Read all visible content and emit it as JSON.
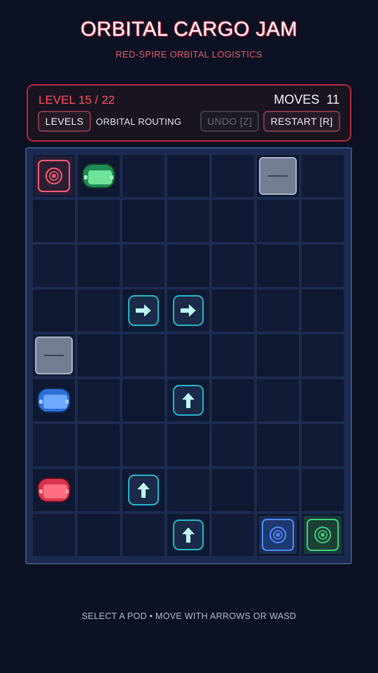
{
  "title": "ORBITAL CARGO JAM",
  "subtitle": "RED-SPIRE ORBITAL LOGISTICS",
  "hud": {
    "level_label": "LEVEL 15 / 22",
    "moves_label": "MOVES",
    "moves_value": "11",
    "levels_button": "LEVELS",
    "mode_label": "ORBITAL ROUTING",
    "undo_button": "UNDO [Z]",
    "restart_button": "RESTART  [R]"
  },
  "board": {
    "columns": 7,
    "rows": 9,
    "tiles": [
      {
        "type": "target",
        "color": "red",
        "col": 0,
        "row": 0
      },
      {
        "type": "pod",
        "color": "green",
        "col": 1,
        "row": 0
      },
      {
        "type": "wall",
        "col": 5,
        "row": 0
      },
      {
        "type": "arrow",
        "direction": "right",
        "col": 2,
        "row": 3
      },
      {
        "type": "arrow",
        "direction": "right",
        "col": 3,
        "row": 3
      },
      {
        "type": "wall",
        "col": 0,
        "row": 4
      },
      {
        "type": "pod",
        "color": "blue",
        "col": 0,
        "row": 5
      },
      {
        "type": "arrow",
        "direction": "up",
        "col": 3,
        "row": 5
      },
      {
        "type": "pod",
        "color": "red",
        "col": 0,
        "row": 7
      },
      {
        "type": "arrow",
        "direction": "up",
        "col": 2,
        "row": 7
      },
      {
        "type": "arrow",
        "direction": "up",
        "col": 3,
        "row": 8
      },
      {
        "type": "target",
        "color": "blue",
        "col": 5,
        "row": 8
      },
      {
        "type": "target",
        "color": "green",
        "col": 6,
        "row": 8
      }
    ]
  },
  "footer": "SELECT A POD • MOVE WITH ARROWS OR WASD",
  "colors": {
    "accent": "#ff4f66",
    "red_pod": "#d8344c",
    "blue_pod": "#2f6fd8",
    "green_pod": "#1f8a52",
    "arrow": "#28b6cc",
    "background": "#0b1022"
  }
}
